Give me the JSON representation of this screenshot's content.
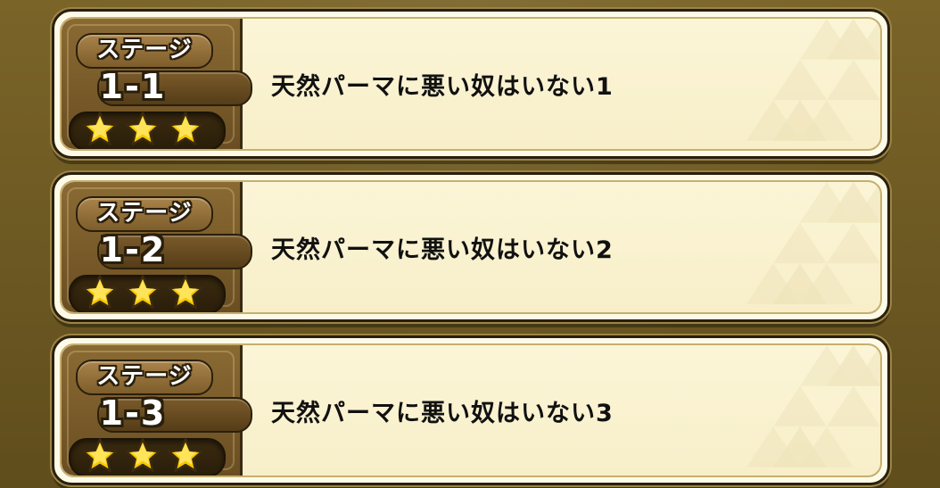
{
  "stages": [
    {
      "label": "ステージ",
      "number": "1-1",
      "title": "天然パーマに悪い奴はいない1",
      "stars_earned": 3,
      "stars_total": 3
    },
    {
      "label": "ステージ",
      "number": "1-2",
      "title": "天然パーマに悪い奴はいない2",
      "stars_earned": 3,
      "stars_total": 3
    },
    {
      "label": "ステージ",
      "number": "1-3",
      "title": "天然パーマに悪い奴はいない3",
      "stars_earned": 3,
      "stars_total": 3
    }
  ],
  "colors": {
    "background": "#6e5a22",
    "card_fill": "#fbf5d7",
    "plate": "#7d5d2b",
    "star_gold": "#f7c800",
    "title_text": "#111111"
  },
  "icons": {
    "star": "star-icon",
    "pattern": "triangle-pattern"
  }
}
